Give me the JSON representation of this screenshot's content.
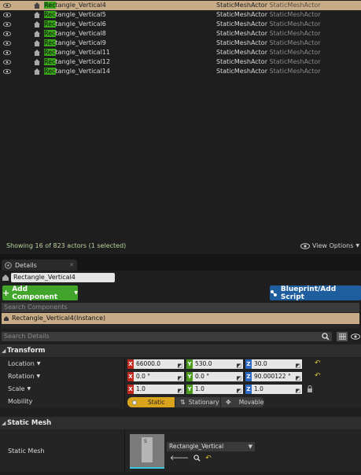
{
  "outliner": {
    "rows": [
      {
        "highlight": "Rec",
        "rest": "tangle_Vertical4",
        "type": "StaticMeshActor",
        "type2": "StaticMeshActor",
        "selected": true
      },
      {
        "highlight": "Rec",
        "rest": "tangle_Vertical5",
        "type": "StaticMeshActor",
        "type2": "StaticMeshActor"
      },
      {
        "highlight": "Rec",
        "rest": "tangle_Vertical6",
        "type": "StaticMeshActor",
        "type2": "StaticMeshActor"
      },
      {
        "highlight": "Rec",
        "rest": "tangle_Vertical8",
        "type": "StaticMeshActor",
        "type2": "StaticMeshActor"
      },
      {
        "highlight": "Rec",
        "rest": "tangle_Vertical9",
        "type": "StaticMeshActor",
        "type2": "StaticMeshActor"
      },
      {
        "highlight": "Rec",
        "rest": "tangle_Vertical11",
        "type": "StaticMeshActor",
        "type2": "StaticMeshActor"
      },
      {
        "highlight": "Rec",
        "rest": "tangle_Vertical12",
        "type": "StaticMeshActor",
        "type2": "StaticMeshActor"
      },
      {
        "highlight": "Rec",
        "rest": "tangle_Vertical14",
        "type": "StaticMeshActor",
        "type2": "StaticMeshActor"
      }
    ],
    "status": "Showing 16 of 823 actors (1 selected)",
    "view_options": "View Options"
  },
  "details": {
    "tab_label": "Details",
    "actor_name": "Rectangle_Vertical4",
    "add_component": "Add Component",
    "blueprint_button": "Blueprint/Add Script",
    "search_components_placeholder": "Search Components",
    "component_instance": "Rectangle_Vertical4(Instance)",
    "search_details_placeholder": "Search Details"
  },
  "transform": {
    "header": "Transform",
    "location": {
      "label": "Location",
      "x": "66000.0",
      "y": "530.0",
      "z": "30.0"
    },
    "rotation": {
      "label": "Rotation",
      "x": "0.0 °",
      "y": "0.0 °",
      "z": "90.000122 °"
    },
    "scale": {
      "label": "Scale",
      "x": "1.0",
      "y": "1.0",
      "z": "1.0"
    },
    "mobility": {
      "label": "Mobility",
      "options": [
        "Static",
        "Stationary",
        "Movable"
      ],
      "selected": "Static"
    }
  },
  "static_mesh": {
    "header": "Static Mesh",
    "label": "Static Mesh",
    "value": "Rectangle_Vertical",
    "thumb_text": "S"
  },
  "colors": {
    "selection": "#c8ac88",
    "green_button": "#40a52a",
    "blue_button": "#1f5e9e",
    "search_highlight": "#3aa619",
    "status_text": "#b9d39c"
  }
}
